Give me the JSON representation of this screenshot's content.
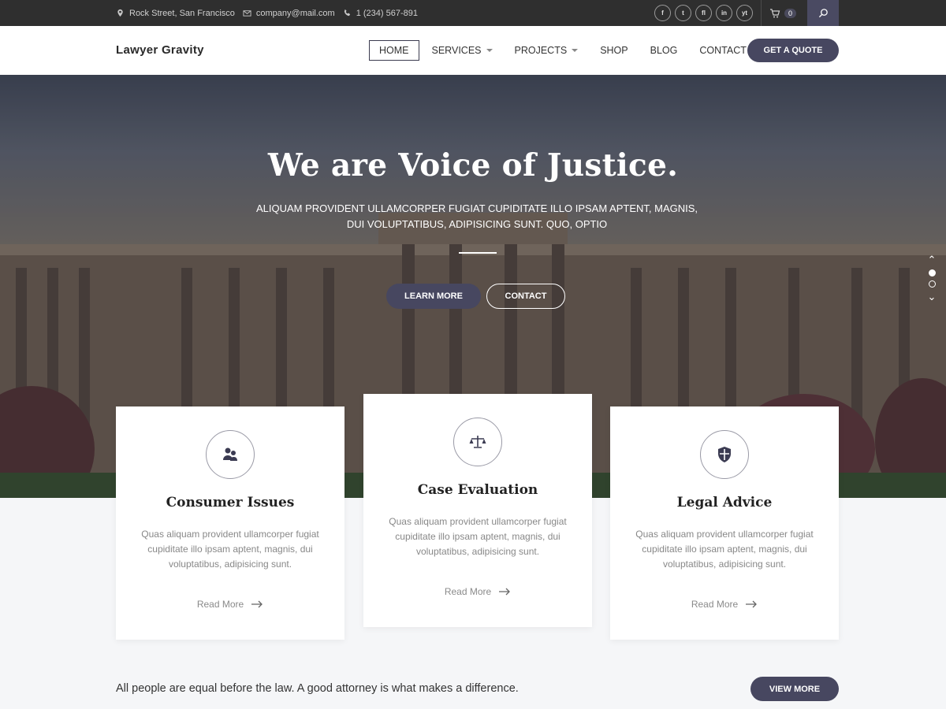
{
  "topbar": {
    "address": "Rock Street, San Francisco",
    "email": "company@mail.com",
    "phone": "1 (234) 567-891",
    "social": [
      "f",
      "t",
      "fl",
      "in",
      "yt"
    ],
    "cart_count": "0",
    "icons": [
      "map-pin-icon",
      "mail-icon",
      "phone-icon",
      "cart-icon",
      "search-icon"
    ]
  },
  "header": {
    "logo": "Lawyer Gravity",
    "nav": [
      {
        "label": "HOME",
        "active": true
      },
      {
        "label": "SERVICES",
        "dropdown": true
      },
      {
        "label": "PROJECTS",
        "dropdown": true
      },
      {
        "label": "SHOP"
      },
      {
        "label": "BLOG"
      },
      {
        "label": "CONTACT"
      }
    ],
    "cta": "GET A QUOTE"
  },
  "hero": {
    "title": "We are Voice of Justice.",
    "subtitle": "ALIQUAM PROVIDENT ULLAMCORPER FUGIAT CUPIDITATE ILLO IPSAM APTENT, MAGNIS, DUI VOLUPTATIBUS, ADIPISICING SUNT. QUO, OPTIO",
    "learn_more": "LEARN MORE",
    "contact": "CONTACT",
    "slide_dots": 2,
    "active_slide": 1
  },
  "cards": [
    {
      "title": "Consumer Issues",
      "text": "Quas aliquam provident ullamcorper fugiat cupiditate illo ipsam aptent, magnis, dui voluptatibus, adipisicing sunt.",
      "link": "Read More",
      "icon": "users-icon"
    },
    {
      "title": "Case Evaluation",
      "text": "Quas aliquam provident ullamcorper fugiat cupiditate illo ipsam aptent, magnis, dui voluptatibus, adipisicing sunt.",
      "link": "Read More",
      "icon": "scales-icon"
    },
    {
      "title": "Legal Advice",
      "text": "Quas aliquam provident ullamcorper fugiat cupiditate illo ipsam aptent, magnis, dui voluptatibus, adipisicing sunt.",
      "link": "Read More",
      "icon": "shield-icon"
    }
  ],
  "bottom": {
    "tagline": "All people are equal before the law. A good attorney is what makes a difference.",
    "button": "VIEW MORE"
  },
  "colors": {
    "accent": "#474760",
    "topbar": "#2f2f2f"
  }
}
